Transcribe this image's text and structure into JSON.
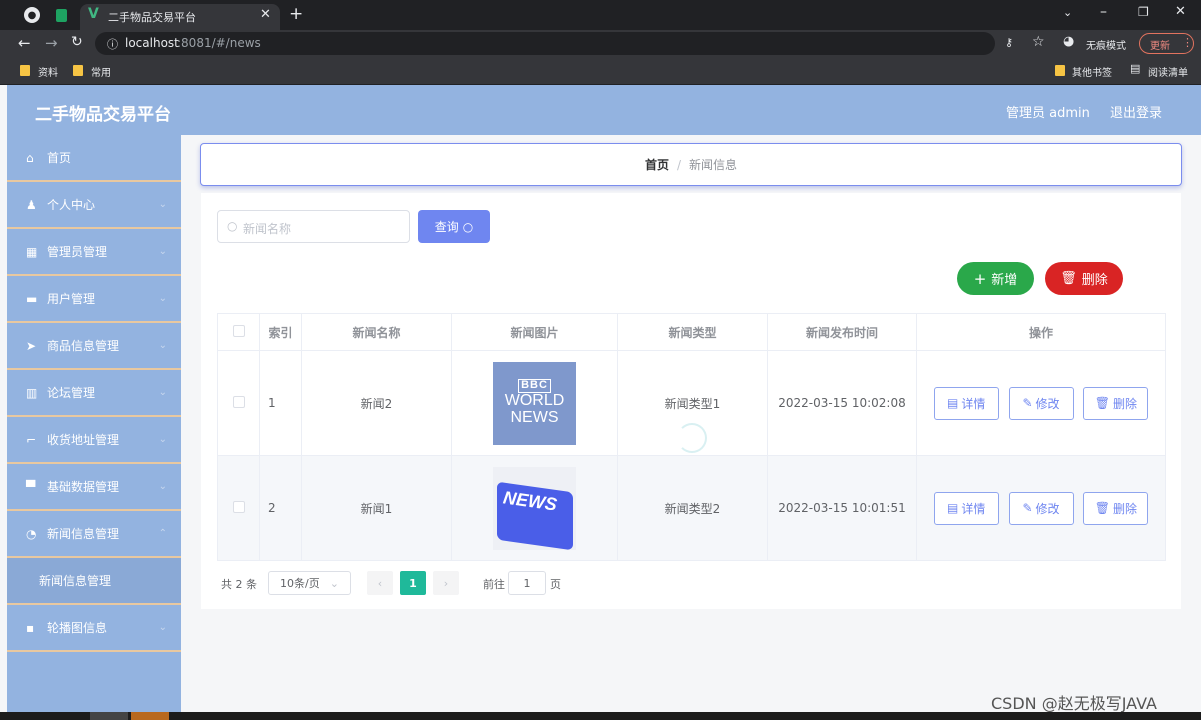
{
  "browser": {
    "tab_title": "二手物品交易平台",
    "url_host": "localhost",
    "url_rest": ":8081/#/news",
    "incognito_label": "无痕模式",
    "update_label": "更新",
    "bookmarks": [
      "资料",
      "常用"
    ],
    "other_bookmarks": "其他书签",
    "reading_list": "阅读清单"
  },
  "header": {
    "app_title": "二手物品交易平台",
    "user_label": "管理员 admin",
    "logout_label": "退出登录"
  },
  "sidebar": {
    "items": [
      {
        "label": "首页",
        "icon": "home-icon"
      },
      {
        "label": "个人中心",
        "icon": "user-icon"
      },
      {
        "label": "管理员管理",
        "icon": "grid-icon"
      },
      {
        "label": "用户管理",
        "icon": "ticket-icon"
      },
      {
        "label": "商品信息管理",
        "icon": "send-icon"
      },
      {
        "label": "论坛管理",
        "icon": "chart-icon"
      },
      {
        "label": "收货地址管理",
        "icon": "crop-icon"
      },
      {
        "label": "基础数据管理",
        "icon": "monitor-icon"
      },
      {
        "label": "新闻信息管理",
        "icon": "gauge-icon"
      },
      {
        "label": "轮播图信息",
        "icon": "apps-icon"
      }
    ],
    "submenu_item": "新闻信息管理"
  },
  "breadcrumb": {
    "home": "首页",
    "separator": "/",
    "current": "新闻信息"
  },
  "search": {
    "placeholder": "新闻名称",
    "button_label": "查询"
  },
  "actions": {
    "add_label": "新增",
    "delete_label": "删除"
  },
  "table": {
    "headers": [
      "索引",
      "新闻名称",
      "新闻图片",
      "新闻类型",
      "新闻发布时间",
      "操作"
    ],
    "rows": [
      {
        "index": "1",
        "name": "新闻2",
        "image_text": [
          "BBC",
          "WORLD",
          "NEWS"
        ],
        "type": "新闻类型1",
        "time": "2022-03-15 10:02:08"
      },
      {
        "index": "2",
        "name": "新闻1",
        "image_text": [
          "NEWS"
        ],
        "type": "新闻类型2",
        "time": "2022-03-15 10:01:51"
      }
    ],
    "row_buttons": {
      "detail": "详情",
      "edit": "修改",
      "delete": "删除"
    }
  },
  "pagination": {
    "total_label": "共 2 条",
    "page_size": "10条/页",
    "current_page": "1",
    "goto_label": "前往",
    "goto_value": "1",
    "page_unit": "页"
  },
  "watermark": "CSDN @赵无极写JAVA",
  "colors": {
    "sidebar": "#93b3e0",
    "primary": "#6f86f0",
    "success": "#2aa84a",
    "danger": "#d92424"
  }
}
